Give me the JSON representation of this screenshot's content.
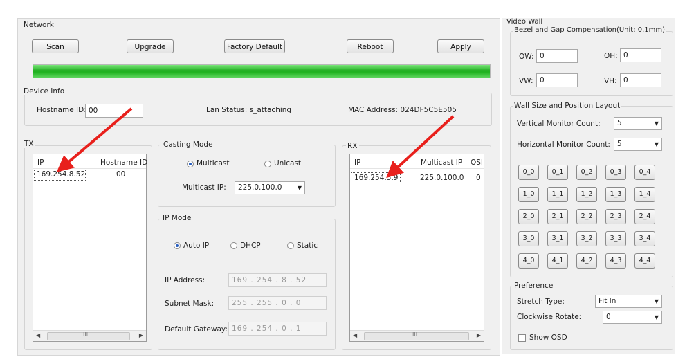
{
  "network": {
    "title": "Network",
    "buttons": {
      "scan": "Scan",
      "upgrade": "Upgrade",
      "factory_default": "Factory Default",
      "reboot": "Reboot",
      "apply": "Apply"
    },
    "progress_fraction": 1.0
  },
  "device_info": {
    "title": "Device Info",
    "hostname_label": "Hostname ID:",
    "hostname_value": "00",
    "lan_status": "Lan Status: s_attaching",
    "mac_address": "MAC Address: 024DF5C5E505"
  },
  "tx": {
    "title": "TX",
    "columns": [
      "IP",
      "Hostname ID"
    ],
    "rows": [
      [
        "169.254.8.52",
        "00"
      ]
    ],
    "scroll_mark": "III"
  },
  "casting_mode": {
    "title": "Casting Mode",
    "multicast": "Multicast",
    "unicast": "Unicast",
    "selected": "Multicast",
    "multicast_ip_label": "Multicast IP:",
    "multicast_ip_value": "225.0.100.0"
  },
  "ip_mode": {
    "title": "IP Mode",
    "auto_ip": "Auto IP",
    "dhcp": "DHCP",
    "static": "Static",
    "selected": "Auto IP",
    "ip_address_label": "IP Address:",
    "ip_address_value": "169 . 254 . 8 . 52",
    "subnet_mask_label": "Subnet Mask:",
    "subnet_mask_value": "255 . 255 . 0 . 0",
    "gateway_label": "Default Gateway:",
    "gateway_value": "169 . 254 . 0 . 1"
  },
  "rx": {
    "title": "RX",
    "columns": [
      "IP",
      "Multicast IP",
      "OSI"
    ],
    "rows": [
      [
        "169.254.5.9",
        "225.0.100.0",
        "0"
      ]
    ],
    "scroll_mark": "III"
  },
  "video_wall": {
    "title": "Video Wall",
    "bezel": {
      "title": "Bezel and Gap Compensation(Unit: 0.1mm)",
      "ow_label": "OW:",
      "ow_value": "0",
      "oh_label": "OH:",
      "oh_value": "0",
      "vw_label": "VW:",
      "vw_value": "0",
      "vh_label": "VH:",
      "vh_value": "0"
    },
    "layout": {
      "title": "Wall Size and Position Layout",
      "vertical_label": "Vertical Monitor Count:",
      "vertical_value": "5",
      "horizontal_label": "Horizontal Monitor Count:",
      "horizontal_value": "5",
      "tiles": [
        [
          "0_0",
          "0_1",
          "0_2",
          "0_3",
          "0_4"
        ],
        [
          "1_0",
          "1_1",
          "1_2",
          "1_3",
          "1_4"
        ],
        [
          "2_0",
          "2_1",
          "2_2",
          "2_3",
          "2_4"
        ],
        [
          "3_0",
          "3_1",
          "3_2",
          "3_3",
          "3_4"
        ],
        [
          "4_0",
          "4_1",
          "4_2",
          "4_3",
          "4_4"
        ]
      ]
    },
    "preference": {
      "title": "Preference",
      "stretch_label": "Stretch Type:",
      "stretch_value": "Fit In",
      "rotate_label": "Clockwise Rotate:",
      "rotate_value": "0",
      "show_osd": "Show OSD",
      "show_osd_checked": false
    }
  },
  "colors": {
    "progress_green": "#2fc02f",
    "annotation_arrow": "#e8201c",
    "radio_selected": "#2a5fbf"
  }
}
